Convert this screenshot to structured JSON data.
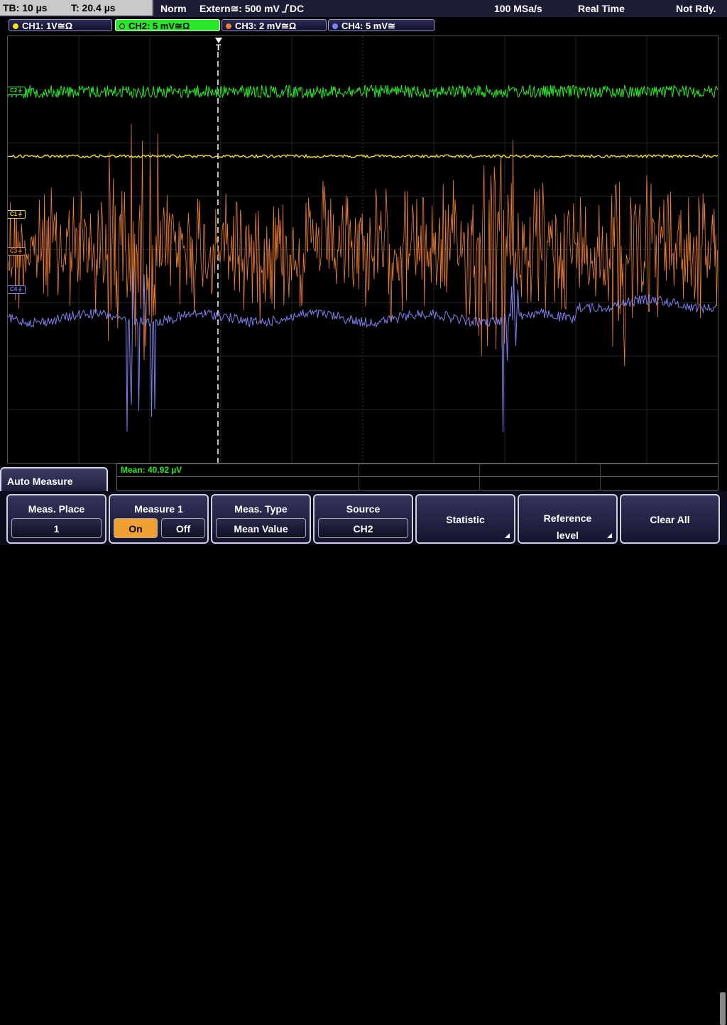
{
  "top_bar": {
    "tb_label": "TB: 10 µs",
    "t_label": "T: 20.4 µs",
    "trigger_mode": "Norm",
    "trigger_source": "Extern≅: 500 mV",
    "trigger_edge_icon": "rising-edge-icon",
    "trigger_coupling": "DC",
    "sample_rate": "100 MSa/s",
    "acq_mode": "Real Time",
    "status": "Not Rdy."
  },
  "channels": [
    {
      "label": "CH1: 1V≅Ω",
      "color": "#f0e020",
      "active": false
    },
    {
      "label": "CH2: 5 mV≅Ω",
      "color": "#28e828",
      "active": true
    },
    {
      "label": "CH3: 2 mV≅Ω",
      "color": "#f08030",
      "active": false
    },
    {
      "label": "CH4: 5 mV≅",
      "color": "#8080f0",
      "active": false
    }
  ],
  "markers": {
    "c1": "C1⏚",
    "c2": "C2⏚",
    "c3": "C3⏚",
    "c4": "C4⏚",
    "trigger_pos": "T"
  },
  "measurement": {
    "result": "Mean: 40.92 µV"
  },
  "menu": {
    "title": "Auto Measure",
    "meas_place_label": "Meas. Place",
    "meas_place_value": "1",
    "measure_label": "Measure 1",
    "on_label": "On",
    "off_label": "Off",
    "on_selected": true,
    "meas_type_label": "Meas. Type",
    "meas_type_value": "Mean Value",
    "source_label": "Source",
    "source_value": "CH2",
    "statistic_label": "Statistic",
    "reference_label_1": "Reference",
    "reference_label_2": "level",
    "clear_all_label": "Clear All"
  },
  "colors": {
    "ch1": "#f0e020",
    "ch2": "#28e828",
    "ch3": "#f08030",
    "ch4": "#8080f0",
    "softkey_highlight": "#f0a030"
  }
}
